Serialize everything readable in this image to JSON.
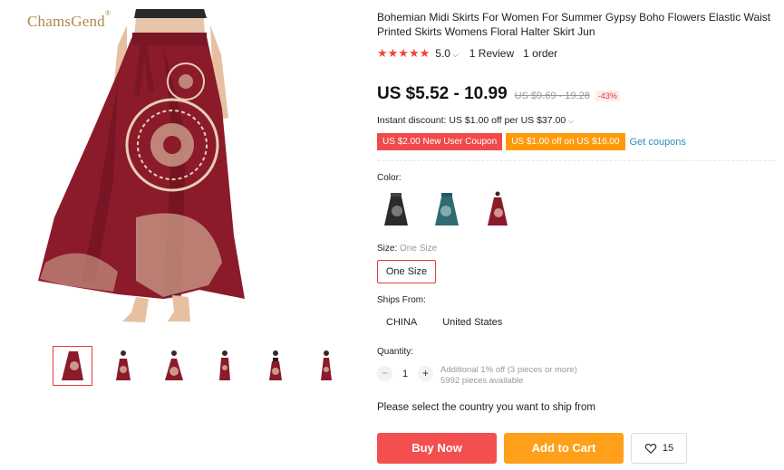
{
  "brand": {
    "name": "ChamsGend",
    "mark": "®"
  },
  "product": {
    "title": "Bohemian Midi Skirts For Women For Summer Gypsy Boho Flowers Elastic Waist Printed Skirts Womens Floral Halter Skirt Jun",
    "rating": {
      "stars": "★★★★★",
      "score": "5.0",
      "reviews": "1 Review",
      "orders": "1 order"
    },
    "price": "US $5.52 - 10.99",
    "original_price": "US $9.69 - 19.28",
    "discount": "-43%",
    "instant_discount": "Instant discount: US $1.00 off per US $37.00",
    "coupons": [
      "US $2.00 New User Coupon",
      "US $1.00 off on US $16.00"
    ],
    "get_coupons": "Get coupons"
  },
  "color": {
    "label": "Color:",
    "swatches": [
      "black-floral-skirt",
      "teal-floral-skirt",
      "red-floral-skirt"
    ]
  },
  "size": {
    "label": "Size:",
    "selected": "One Size",
    "option": "One Size"
  },
  "ships_from": {
    "label": "Ships From:",
    "options": [
      "CHINA",
      "United States"
    ]
  },
  "quantity": {
    "label": "Quantity:",
    "minus": "−",
    "value": "1",
    "plus": "+",
    "note_line1": "Additional 1% off (3 pieces or more)",
    "note_line2": "5992 pieces available"
  },
  "ship_notice": "Please select the country you want to ship from",
  "actions": {
    "buy_now": "Buy Now",
    "add_to_cart": "Add to Cart",
    "wishlist_count": "15"
  },
  "colors": {
    "accent_red": "#e4393c",
    "buy_red": "#f34f4f",
    "cart_orange": "#ff9f1a",
    "coupon_red": "#f04a4a",
    "coupon_orange": "#ff9a0a",
    "link_blue": "#2a8fbd",
    "skirt_wine": "#8b1a2b"
  }
}
